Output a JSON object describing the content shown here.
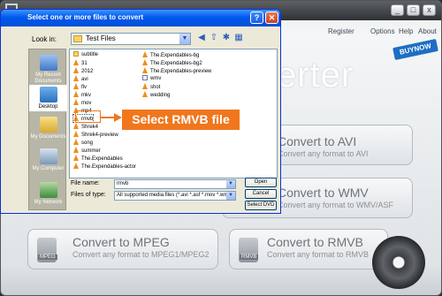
{
  "dialog": {
    "title": "Select one or more files to convert",
    "help_glyph": "?",
    "close_glyph": "✕",
    "look_in_label": "Look in:",
    "look_in_value": "Test Files",
    "file_name_label": "File name:",
    "file_name_value": "rmvb",
    "files_of_type_label": "Files of type:",
    "files_of_type_value": "All supported media files (*.avi *.asf *.mov *.wmv",
    "buttons": {
      "open": "Open",
      "cancel": "Cancel",
      "select_dvd": "Select DVD"
    },
    "places": [
      {
        "label": "My Recent Documents"
      },
      {
        "label": "Desktop"
      },
      {
        "label": "My Documents"
      },
      {
        "label": "My Computer"
      },
      {
        "label": "My Network"
      }
    ],
    "files_col1": [
      "subtitle",
      "31",
      "2012",
      "avi",
      "flv",
      "mkv",
      "mov",
      "mp4",
      "rmvb",
      "Shrek4",
      "Shrek4-preview",
      "song",
      "summer",
      "The.Expendables",
      "The.Expendables-actor"
    ],
    "files_col2": [
      "The.Expendables-bg",
      "The.Expendables-bg2",
      "The.Expendables-preview",
      "wmv",
      "shot",
      "wedding"
    ],
    "callout": "Select RMVB file"
  },
  "app": {
    "menu": {
      "register": "Register",
      "options": "Options",
      "help": "Help",
      "about": "About"
    },
    "buy_now": "BUYNOW",
    "title_fragment": "erter",
    "window_controls": {
      "minimize": "_",
      "maximize": "□",
      "close": "x"
    },
    "buttons": [
      {
        "title": "Convert to AVI",
        "subtitle": "Convert any format to AVI"
      },
      {
        "title": "Convert to WMV",
        "subtitle": "Convert any format to WMV/ASF"
      },
      {
        "title": "Convert to MPEG",
        "subtitle": "Convert any format to MPEG1/MPEG2",
        "icon_label": "MPEG"
      },
      {
        "title": "Convert to RMVB",
        "subtitle": "Convert any format to RMVB",
        "icon_label": "RMVB"
      }
    ]
  },
  "colors": {
    "dialog_title": "#0058ee",
    "callout": "#f0771d",
    "dialog_bg": "#ece9d8"
  }
}
